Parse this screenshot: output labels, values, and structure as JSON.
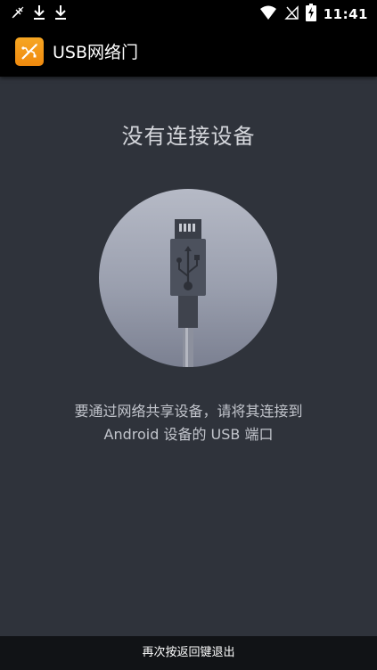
{
  "status_bar": {
    "time": "11:41",
    "left_icons": [
      "no-sim-usb-icon",
      "download-icon",
      "download-icon"
    ],
    "right_icons": [
      "wifi-icon",
      "no-signal-icon",
      "battery-charging-icon"
    ]
  },
  "app_bar": {
    "title": "USB网络门",
    "icon": "usb-tether-app-icon",
    "icon_color": "#f39c1a"
  },
  "main": {
    "title": "没有连接设备",
    "illustration": "usb-cable-icon",
    "desc_line1": "要通过网络共享设备，请将其连接到",
    "desc_line2": "Android 设备的 USB 端口"
  },
  "toast": {
    "text": "再次按返回键退出"
  },
  "colors": {
    "background": "#2f333b",
    "bars": "#000000",
    "circle_top": "#b6bac6",
    "circle_bottom": "#7b8091"
  }
}
